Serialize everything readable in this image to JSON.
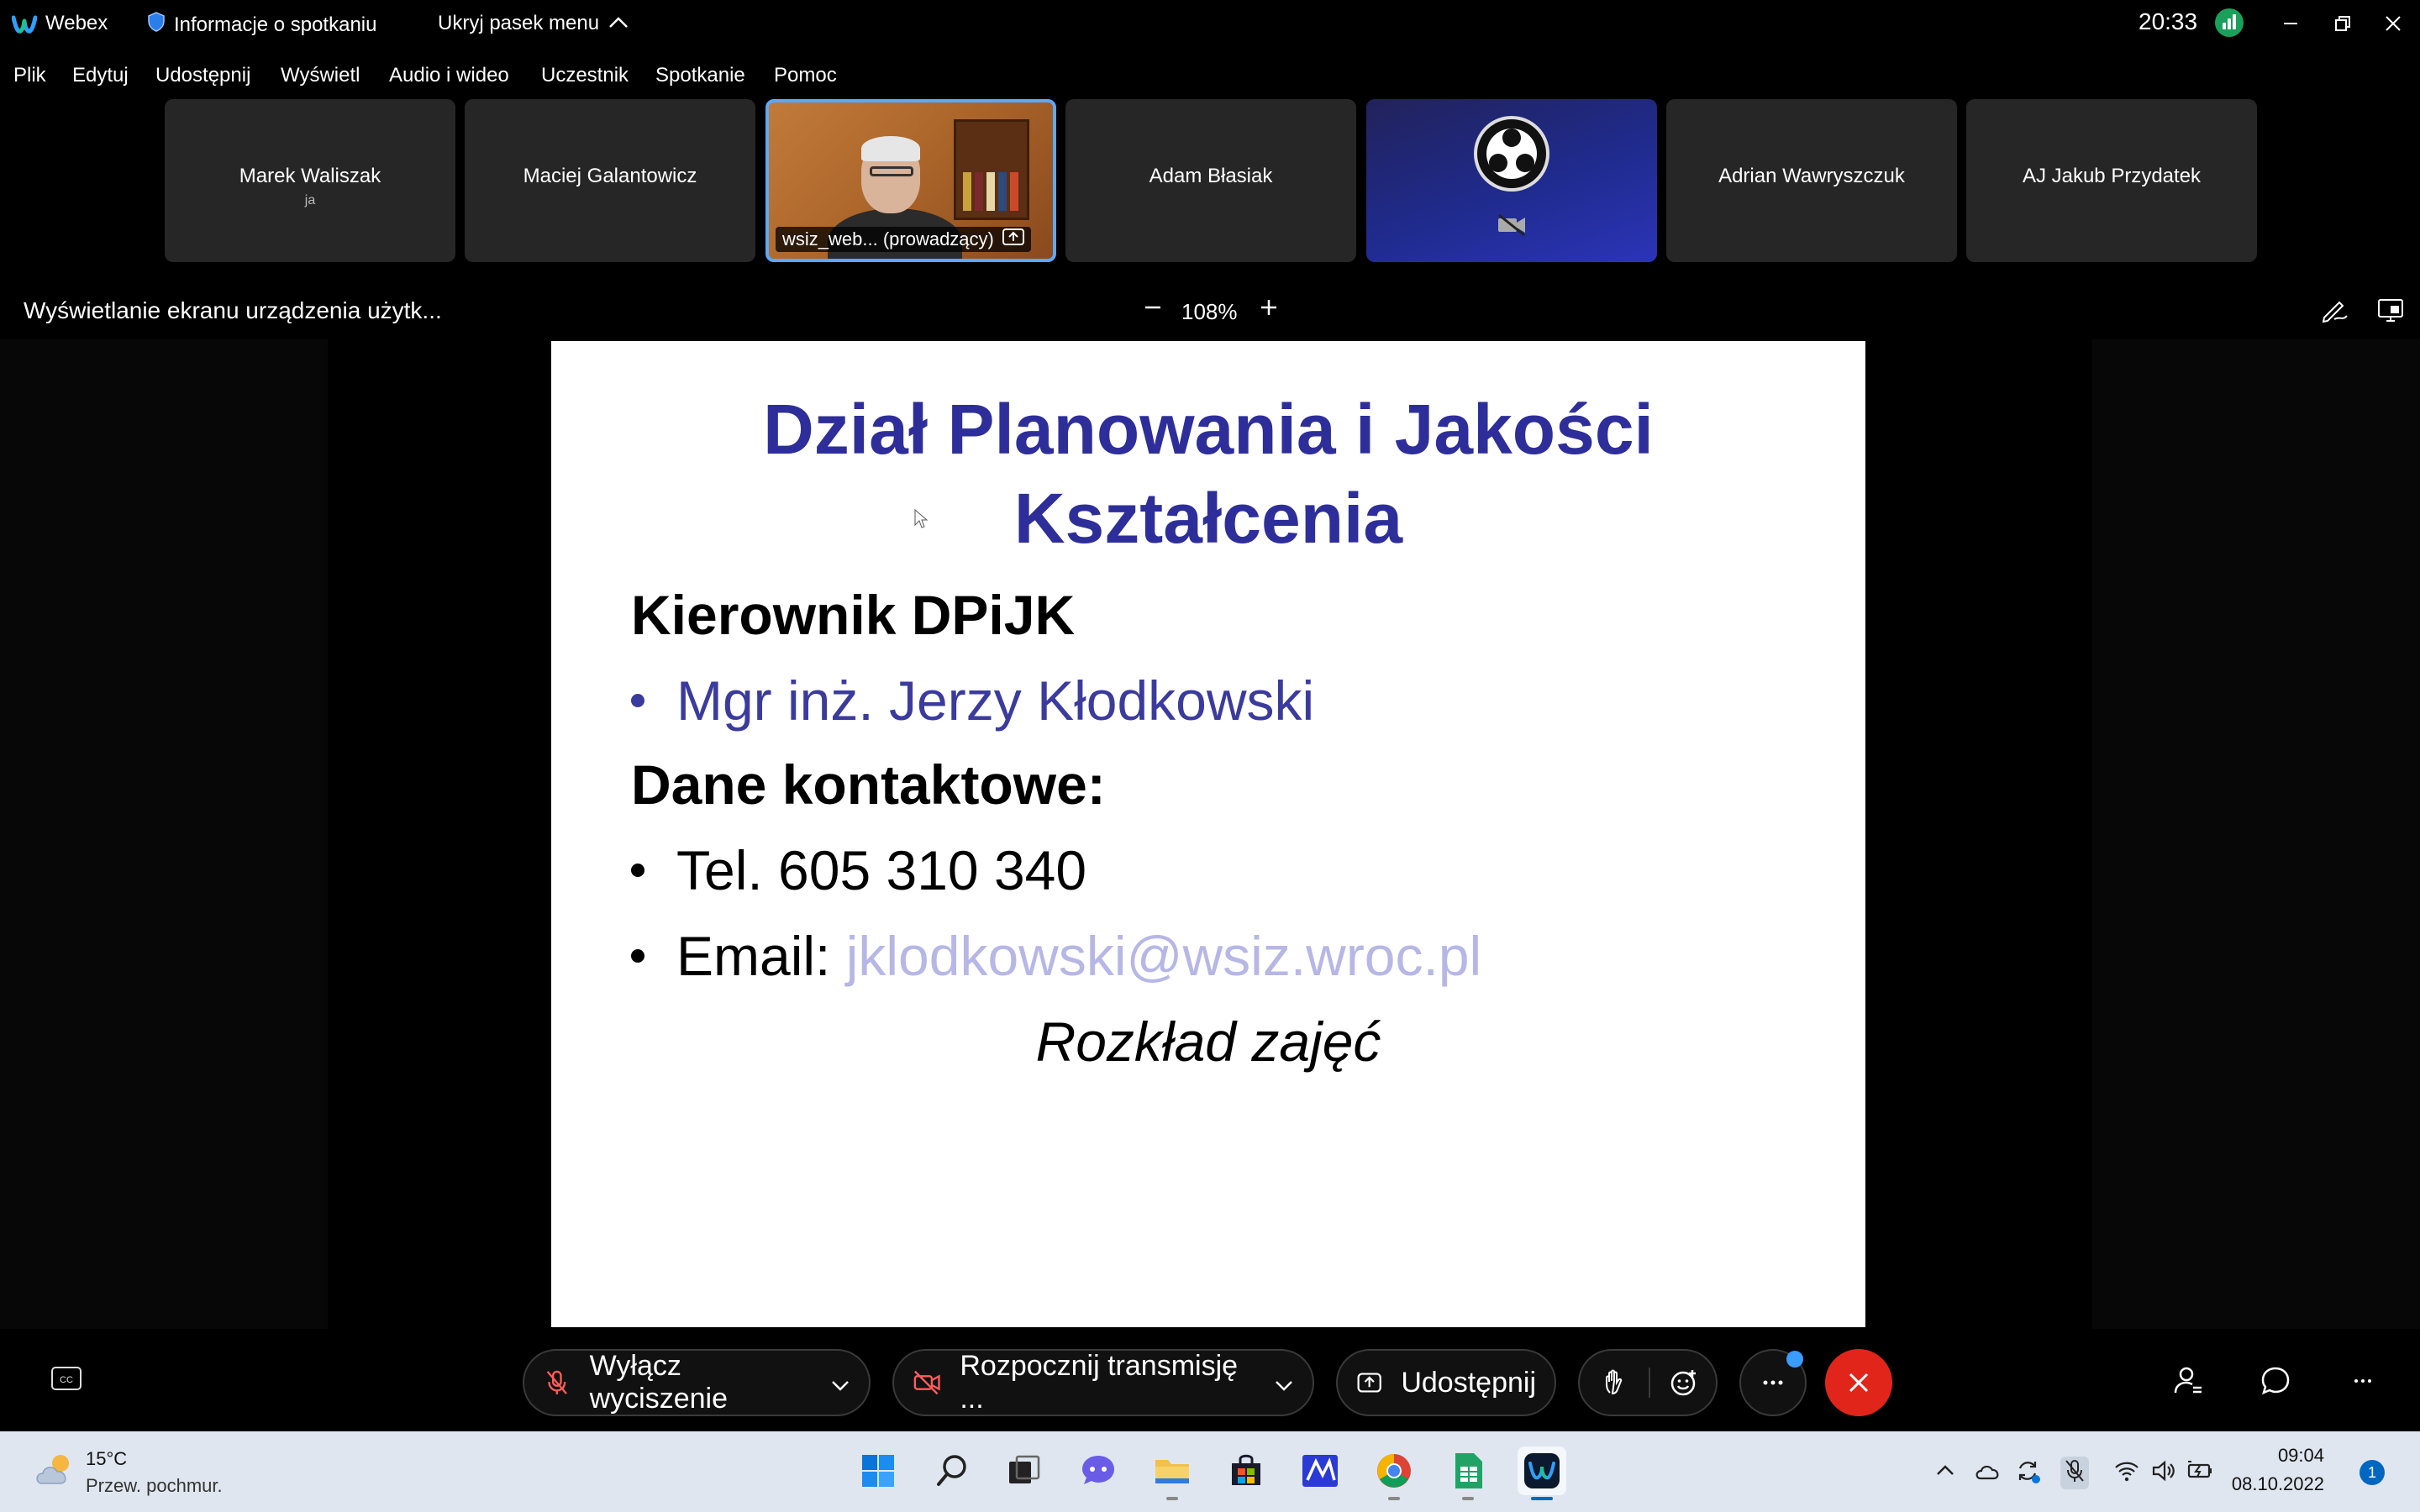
{
  "titlebar": {
    "app_name": "Webex",
    "meeting_info": "Informacje o spotkaniu",
    "hide_menu": "Ukryj pasek menu",
    "time": "20:33"
  },
  "menu": [
    "Plik",
    "Edytuj",
    "Udostępnij",
    "Wyświetl",
    "Audio i wideo",
    "Uczestnik",
    "Spotkanie",
    "Pomoc"
  ],
  "participants": [
    {
      "name": "Marek Waliszak",
      "sub": "ja"
    },
    {
      "name": "Maciej Galantowicz"
    },
    {
      "name": "wsiz_web... (prowadzący)",
      "active": true
    },
    {
      "name": "Adam Błasiak"
    },
    {
      "name": "",
      "obs": true
    },
    {
      "name": "Adrian Wawryszczuk"
    },
    {
      "name": "AJ Jakub Przydatek"
    }
  ],
  "share": {
    "title": "Wyświetlanie ekranu urządzenia użytk...",
    "zoom": "108%"
  },
  "slide": {
    "title_line1": "Dział Planowania i Jakości",
    "title_line2": "Kształcenia",
    "heading1": "Kierownik DPiJK",
    "person": "Mgr inż. Jerzy Kłodkowski",
    "heading2": "Dane kontaktowe:",
    "phone": "Tel. 605 310 340",
    "email_label": "Email: ",
    "email": "jklodkowski@wsiz.wroc.pl",
    "schedule": "Rozkład zajęć"
  },
  "controls": {
    "unmute": "Wyłącz wyciszenie",
    "start_video": "Rozpocznij transmisję ...",
    "share": "Udostępnij",
    "end_color": "#e1251b"
  },
  "taskbar": {
    "temp": "15°C",
    "weather": "Przew. pochmur.",
    "clock": "09:04",
    "date": "08.10.2022",
    "notifications": "1"
  },
  "colors": {
    "slide_title": "#2e2e9a",
    "active_border": "#5aa9ff",
    "accent": "#0067c0"
  }
}
